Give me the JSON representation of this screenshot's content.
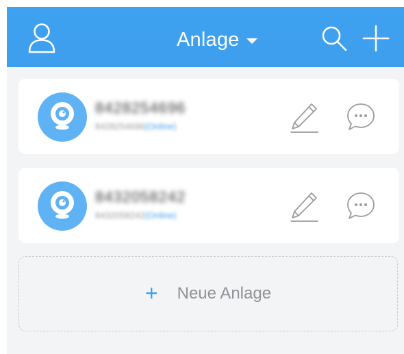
{
  "header": {
    "title": "Anlage",
    "background": "#3d9eee"
  },
  "devices": [
    {
      "id_text": "8428254696",
      "sub_id": "8428254696",
      "status": "(Online)"
    },
    {
      "id_text": "8432058242",
      "sub_id": "8432058242",
      "status": "(Online)"
    }
  ],
  "add_device": {
    "plus": "+",
    "label": "Neue Anlage"
  },
  "icons": {
    "profile": "person-icon",
    "search": "search-icon",
    "add": "plus-icon",
    "camera": "camera-icon",
    "edit": "pencil-icon",
    "message": "chat-bubble-icon"
  }
}
